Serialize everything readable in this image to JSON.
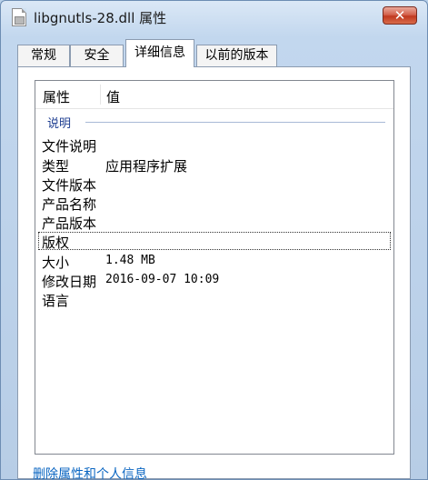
{
  "window": {
    "title": "libgnutls-28.dll 属性",
    "close_label": "✕"
  },
  "tabs": [
    {
      "label": "常规",
      "active": false
    },
    {
      "label": "安全",
      "active": false
    },
    {
      "label": "详细信息",
      "active": true
    },
    {
      "label": "以前的版本",
      "active": false
    }
  ],
  "details": {
    "columns": {
      "property": "属性",
      "value": "值"
    },
    "group": "说明",
    "rows": [
      {
        "property": "文件说明",
        "value": ""
      },
      {
        "property": "类型",
        "value": "应用程序扩展"
      },
      {
        "property": "文件版本",
        "value": ""
      },
      {
        "property": "产品名称",
        "value": ""
      },
      {
        "property": "产品版本",
        "value": ""
      },
      {
        "property": "版权",
        "value": "",
        "selected": true
      },
      {
        "property": "大小",
        "value": "1.48 MB"
      },
      {
        "property": "修改日期",
        "value": "2016-09-07 10:09"
      },
      {
        "property": "语言",
        "value": ""
      }
    ]
  },
  "footer": {
    "link": "删除属性和个人信息"
  },
  "colors": {
    "link": "#0b66c2",
    "group": "#1e3e91",
    "close_button": "#c0391f"
  }
}
